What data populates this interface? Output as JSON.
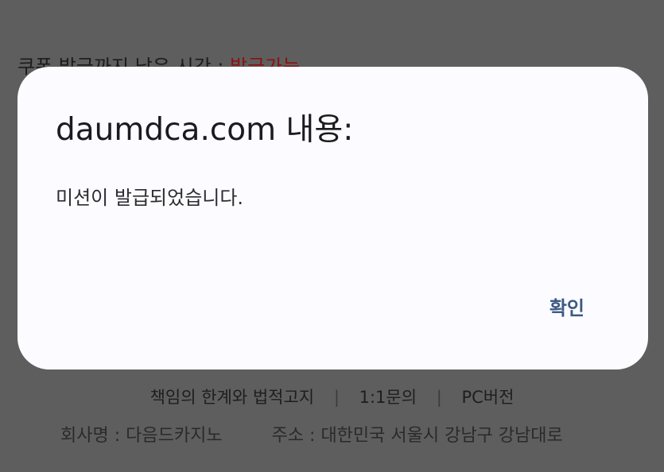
{
  "background": {
    "coupon_label": "쿠폰 발급까지 남은 시간 : ",
    "coupon_status": "발급가능",
    "footer_links": [
      "책임의 한계와 법적고지",
      "1:1문의",
      "PC버전"
    ],
    "footer_separator": "|",
    "company_name": "회사명 : 다음드카지노",
    "company_address": "주소 : 대한민국 서울시 강남구 강남대로"
  },
  "dialog": {
    "title": "daumdca.com 내용:",
    "message": "미션이 발급되었습니다.",
    "ok_label": "확인"
  },
  "colors": {
    "overlay_background": "#5e5e5e",
    "dialog_background": "#fcfbff",
    "coupon_status": "#8a1212",
    "ok_button": "#3d5a80"
  }
}
